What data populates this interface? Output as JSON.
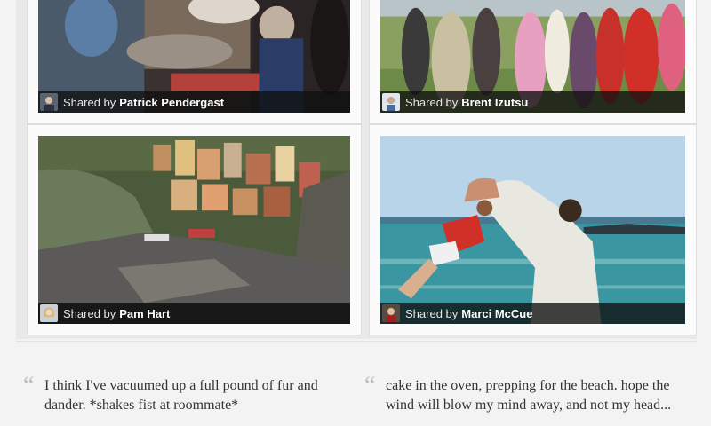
{
  "gallery": {
    "items": [
      {
        "shared_prefix": "Shared by",
        "user": "Patrick Pendergast",
        "photo_icon": "photo-office-people-icon",
        "avatar_icon": "avatar-icon"
      },
      {
        "shared_prefix": "Shared by",
        "user": "Brent Izutsu",
        "photo_icon": "photo-crowd-outdoors-icon",
        "avatar_icon": "avatar-icon"
      },
      {
        "shared_prefix": "Shared by",
        "user": "Pam Hart",
        "photo_icon": "photo-coastal-village-icon",
        "avatar_icon": "avatar-icon"
      },
      {
        "shared_prefix": "Shared by",
        "user": "Marci McCue",
        "photo_icon": "photo-beach-swing-icon",
        "avatar_icon": "avatar-icon"
      }
    ]
  },
  "quotes": [
    {
      "text": "I think I've vacuumed up a full pound of fur and dander. *shakes fist at roommate*"
    },
    {
      "text": "cake in the oven, prepping for the beach. hope the wind will blow my mind away, and not my head..."
    }
  ],
  "colors": {
    "page_bg": "#f3f3f3",
    "caption_bg": "#0f0f0f",
    "quote_mark": "#bdbdbd"
  }
}
